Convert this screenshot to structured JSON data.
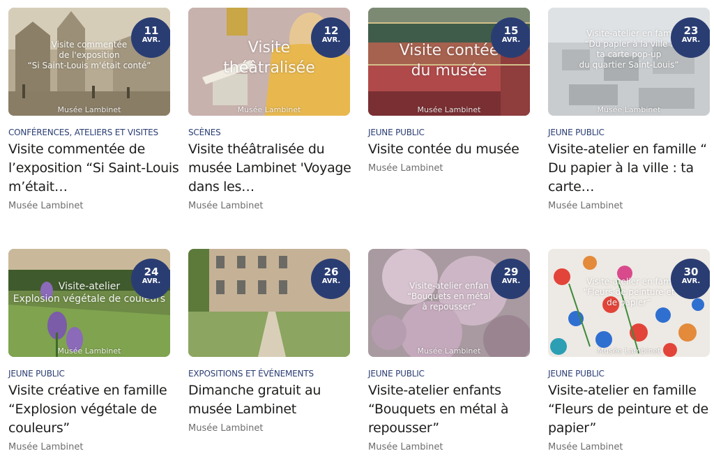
{
  "events": [
    {
      "overlay": [
        "Visite commentée",
        "de l'exposition",
        "“Si Saint-Louis m'était conté”"
      ],
      "watermark": "Musée Lambinet",
      "day": "11",
      "month": "AVR.",
      "category": "Conférences, ateliers et visites",
      "title": "Visite commentée de l’exposition “Si Saint-Louis m’était…",
      "venue": "Musée Lambinet"
    },
    {
      "overlay": [
        "Visite",
        "théâtralisée"
      ],
      "watermark": "Musée Lambinet",
      "day": "12",
      "month": "AVR.",
      "category": "Scènes",
      "title": "Visite théâtralisée du musée Lambinet 'Voyage dans les…",
      "venue": "Musée Lambinet"
    },
    {
      "overlay": [
        "Visite contée",
        "du musée"
      ],
      "watermark": "Musée Lambinet",
      "day": "15",
      "month": "AVR.",
      "category": "Jeune public",
      "title": "Visite contée du musée",
      "venue": "Musée Lambinet"
    },
    {
      "overlay": [
        "Visite-atelier en fam",
        "“Du papier à la ville :",
        "ta carte pop-up",
        "du quartier Saint-Louis”"
      ],
      "watermark": "Musée Lambinet",
      "day": "23",
      "month": "AVR.",
      "category": "Jeune public",
      "title": "Visite-atelier en famille “ Du papier à la ville : ta carte…",
      "venue": "Musée Lambinet"
    },
    {
      "overlay": [
        "Visite-atelier",
        "Explosion végétale de couleurs"
      ],
      "watermark": "Musée Lambinet",
      "day": "24",
      "month": "AVR.",
      "category": "Jeune public",
      "title": "Visite créative en famille “Explosion végétale de couleurs”",
      "venue": "Musée Lambinet"
    },
    {
      "overlay": [],
      "watermark": "",
      "day": "26",
      "month": "AVR.",
      "category": "Expositions et événements",
      "title": "Dimanche gratuit au musée Lambinet",
      "venue": "Musée Lambinet"
    },
    {
      "overlay": [
        "Visite-atelier enfan",
        "“Bouquets en métal",
        "à repousser”"
      ],
      "watermark": "Musée Lambinet",
      "day": "29",
      "month": "AVR.",
      "category": "Jeune public",
      "title": "Visite-atelier enfants “Bouquets en métal à repousser”",
      "venue": "Musée Lambinet"
    },
    {
      "overlay": [
        "Visite-atelier en fam",
        "“Fleurs de peinture et",
        "de papier”"
      ],
      "watermark": "Musée Lambinet",
      "day": "30",
      "month": "AVR.",
      "category": "Jeune public",
      "title": "Visite-atelier en famille “Fleurs de peinture et de papier”",
      "venue": "Musée Lambinet"
    }
  ],
  "colors": {
    "badge": "#2a3d73",
    "category": "#2a3d73",
    "title": "#1d1d1b",
    "venue": "#6d6d6d"
  }
}
